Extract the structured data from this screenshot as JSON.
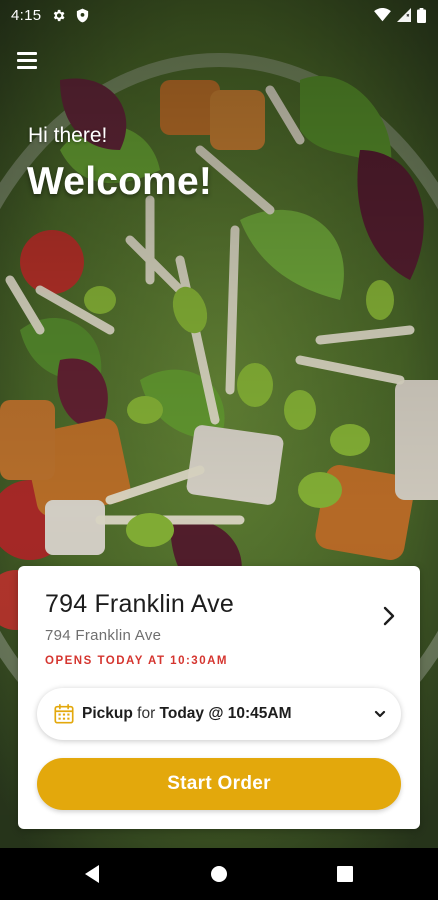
{
  "status_bar": {
    "time": "4:15",
    "left_icons": [
      "gear-icon",
      "shield-icon"
    ],
    "right_icons": [
      "wifi-icon",
      "cell-signal-icon",
      "battery-icon"
    ]
  },
  "header": {
    "menu_icon": "hamburger-menu-icon",
    "greeting": "Hi there!",
    "welcome": "Welcome!"
  },
  "store": {
    "name": "794 Franklin Ave",
    "address": "794 Franklin Ave",
    "hours_status": "OPENS TODAY AT 10:30AM",
    "chevron_icon": "chevron-right-icon"
  },
  "order_time": {
    "icon": "calendar-icon",
    "mode": "Pickup",
    "connector": "for",
    "time": "Today @ 10:45AM",
    "dropdown_icon": "chevron-down-icon"
  },
  "actions": {
    "start_order": "Start Order"
  },
  "navigation": {
    "buttons": [
      "back-icon",
      "home-icon",
      "recents-icon"
    ]
  },
  "colors": {
    "accent": "#e3a80c",
    "hours_red": "#d5352f",
    "card": "#ffffff",
    "calendar_icon": "#e3a80c"
  }
}
